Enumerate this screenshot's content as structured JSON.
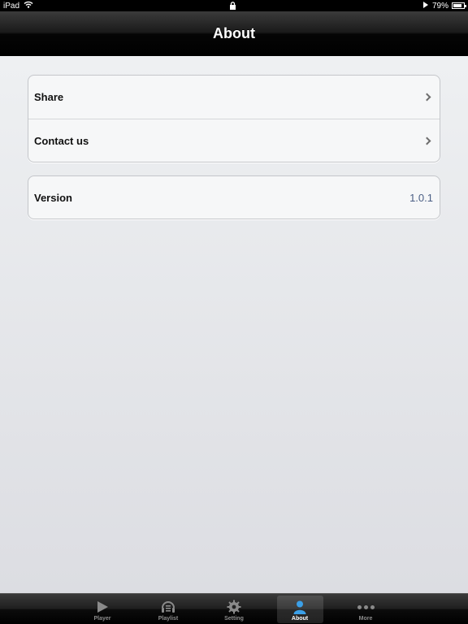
{
  "status_bar": {
    "device": "iPad",
    "battery": "79%"
  },
  "nav": {
    "title": "About"
  },
  "groups": {
    "links": [
      {
        "label": "Share"
      },
      {
        "label": "Contact us"
      }
    ],
    "info": {
      "version_label": "Version",
      "version_value": "1.0.1"
    }
  },
  "tabbar": {
    "active": "About",
    "tabs": [
      {
        "label": "Player",
        "icon": "play-icon"
      },
      {
        "label": "Playlist",
        "icon": "playlist-icon"
      },
      {
        "label": "Setting",
        "icon": "gear-icon"
      },
      {
        "label": "About",
        "icon": "person-icon"
      },
      {
        "label": "More",
        "icon": "more-dots-icon"
      }
    ]
  },
  "colors": {
    "accent_value": "#4a5e84",
    "active_icon": "#3ba0e8"
  }
}
